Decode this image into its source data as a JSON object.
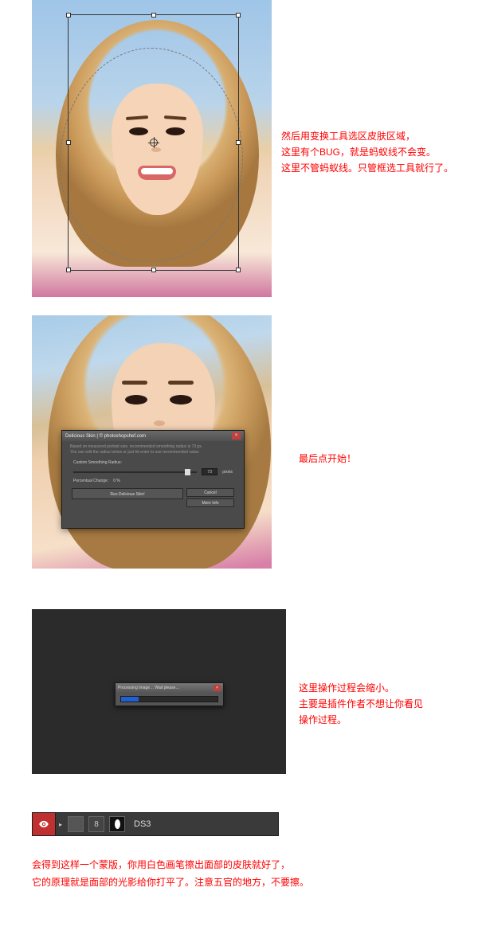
{
  "section1": {
    "text": "然后用变换工具选区皮肤区域，\n这里有个BUG，就是蚂蚁线不会变。\n这里不管蚂蚁线。只管框选工具就行了。"
  },
  "section2": {
    "text": "最后点开始！",
    "dialog": {
      "title": "Delicious Skin | © photoshopchef.com",
      "desc": "Based on measured portrait size, recommended smoothing radius is 73 px.\nYou can edit the radius below or just hit enter to use recommended value.",
      "slider_label": "Custom Smoothing Radius:",
      "slider_value": "73",
      "slider_unit": "pixels",
      "percent_label": "Percentual Change:",
      "percent_value": "0 %",
      "btn_run": "Run Delicious Skin!",
      "btn_cancel": "Cancel",
      "btn_more": "More Info"
    }
  },
  "section3": {
    "text": "这里操作过程会缩小。\n主要是插件作者不想让你看见\n操作过程。",
    "progress_title": "Processing Image… Wait please…"
  },
  "section4": {
    "layer_name": "DS3",
    "text": "会得到这样一个蒙版，你用白色画笔擦出面部的皮肤就好了，\n它的原理就是面部的光影给你打平了。注意五官的地方，不要擦。"
  }
}
